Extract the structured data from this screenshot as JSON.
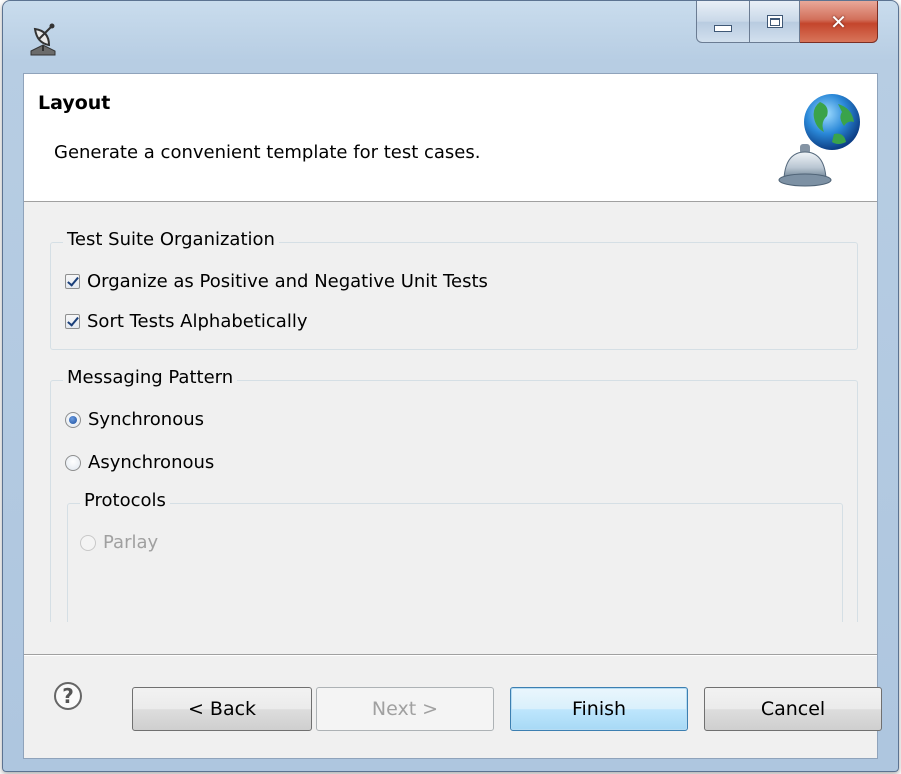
{
  "window": {
    "controls": {
      "minimize": "minimize",
      "maximize": "maximize",
      "close": "close"
    }
  },
  "header": {
    "title": "Layout",
    "description": "Generate a convenient template for test cases."
  },
  "groups": {
    "organization": {
      "label": "Test Suite Organization",
      "options": [
        {
          "label": "Organize as Positive and Negative Unit Tests",
          "checked": true
        },
        {
          "label": "Sort Tests Alphabetically",
          "checked": true
        }
      ]
    },
    "messaging": {
      "label": "Messaging Pattern",
      "options": [
        {
          "label": "Synchronous",
          "selected": true
        },
        {
          "label": "Asynchronous",
          "selected": false
        }
      ],
      "protocols": {
        "label": "Protocols",
        "options": [
          {
            "label": "Parlay",
            "selected": false,
            "enabled": false
          }
        ]
      }
    }
  },
  "buttons": {
    "help": "?",
    "back": "< Back",
    "next": "Next >",
    "finish": "Finish",
    "cancel": "Cancel"
  },
  "icons": {
    "app": "satellite-dish-icon",
    "wizard_banner": "globe-on-bell-icon",
    "help": "help-icon"
  },
  "colors": {
    "close_button": "#c4452c",
    "default_button_border": "#3c7fb1",
    "header_background": "#ffffff",
    "body_background": "#f0f0f0"
  }
}
